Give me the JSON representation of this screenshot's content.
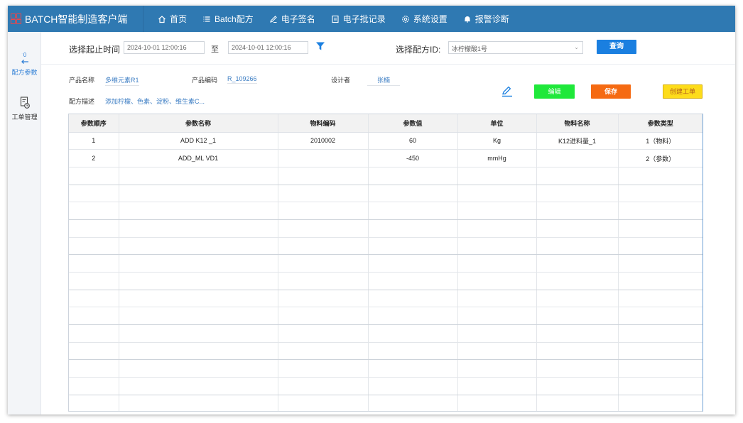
{
  "app": {
    "title": "BATCH智能制造客户端"
  },
  "nav": [
    {
      "label": "首页",
      "icon": "home-icon"
    },
    {
      "label": "Batch配方",
      "icon": "list-icon"
    },
    {
      "label": "电子签名",
      "icon": "pen-icon"
    },
    {
      "label": "电子批记录",
      "icon": "record-icon"
    },
    {
      "label": "系统设置",
      "icon": "gear-icon"
    },
    {
      "label": "报警诊断",
      "icon": "bell-icon"
    }
  ],
  "sidebar": {
    "items": [
      {
        "label": "配方参数",
        "icon": "recipe-param-icon",
        "active": true
      },
      {
        "label": "工单管理",
        "icon": "work-order-icon",
        "active": false
      }
    ]
  },
  "filter": {
    "time_label": "选择起止时间",
    "start": "2024-10-01 12:00:16",
    "to_label": "至",
    "end": "2024-10-01 12:00:16",
    "recipe_label": "选择配方ID:",
    "recipe_value": "冰柠檬酸1号",
    "query_label": "查询"
  },
  "info": {
    "product_name_label": "产品名称",
    "product_name": "多维元素R1",
    "product_code_label": "产品编码",
    "product_code": "R_109266",
    "designer_label": "设计者",
    "designer": "张楠",
    "desc_label": "配方描述",
    "desc": "添加柠檬、色素、淀粉、维生素C..."
  },
  "actions": {
    "edit_label": "编辑",
    "save_label": "保存",
    "create_label": "创建工单"
  },
  "colors": {
    "topbar": "#2f79b2",
    "accent": "#1a7fe0",
    "edit": "#1fe83a",
    "save": "#f56a12",
    "create": "#fddc1a",
    "logo": "#e8474b"
  },
  "table": {
    "columns": [
      "参数顺序",
      "参数名称",
      "物料编码",
      "参数值",
      "单位",
      "物料名称",
      "参数类型"
    ],
    "rows": [
      [
        "1",
        "ADD K12 _1",
        "2010002",
        "60",
        "Kg",
        "K12进料量_1",
        "1（物料）"
      ],
      [
        "2",
        "ADD_ML VD1",
        "",
        "-450",
        "mmHg",
        "",
        "2（参数）"
      ]
    ]
  }
}
